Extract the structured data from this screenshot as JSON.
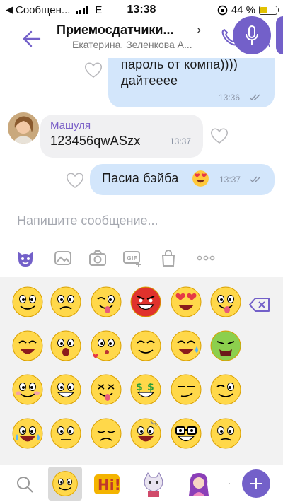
{
  "status_bar": {
    "carrier": "Сообщен...",
    "network": "E",
    "time": "13:38",
    "battery": "44 %",
    "battery_level": 0.44
  },
  "header": {
    "title": "Приемосдатчики...",
    "chevron": "›",
    "subtitle": "Екатерина, Зеленкова А..."
  },
  "messages": [
    {
      "direction": "out",
      "lines": [
        "пароль от компа))))",
        "дайтееее"
      ],
      "time": "13:36",
      "read": true
    },
    {
      "direction": "in",
      "sender": "Машуля",
      "text": "123456qwASzx",
      "time": "13:37"
    },
    {
      "direction": "out",
      "text": "Пасиа бэйба",
      "emoji": "heart-eyes",
      "time": "13:37",
      "read": true
    }
  ],
  "composer": {
    "placeholder": "Напишите сообщение..."
  },
  "toolbar_icons": [
    "sticker-icon",
    "gallery-icon",
    "camera-icon",
    "gif-icon",
    "shop-icon",
    "more-icon"
  ],
  "emoji_grid": [
    [
      "smile",
      "worried",
      "wink-tongue",
      "angry-red",
      "heart-eyes",
      "tongue"
    ],
    [
      "laugh",
      "shocked",
      "kiss",
      "grin",
      "sweat-laugh",
      "sick"
    ],
    [
      "sad-smile",
      "big-grin",
      "dizzy",
      "dollar-eyes",
      "smirk",
      "wink"
    ],
    [
      "laugh-tears",
      "surprised",
      "pensive",
      "crazy",
      "nerd",
      "confused"
    ]
  ],
  "bottom_tabs": [
    "search-icon",
    "smiley-pack",
    "hi-pack",
    "cat-pack",
    "girl-pack"
  ],
  "bottom_dot": ".",
  "colors": {
    "accent": "#7360c9",
    "bubble_out": "#d3e6fb",
    "bubble_in": "#f0f0f2",
    "emoji": "#ffd84a"
  }
}
